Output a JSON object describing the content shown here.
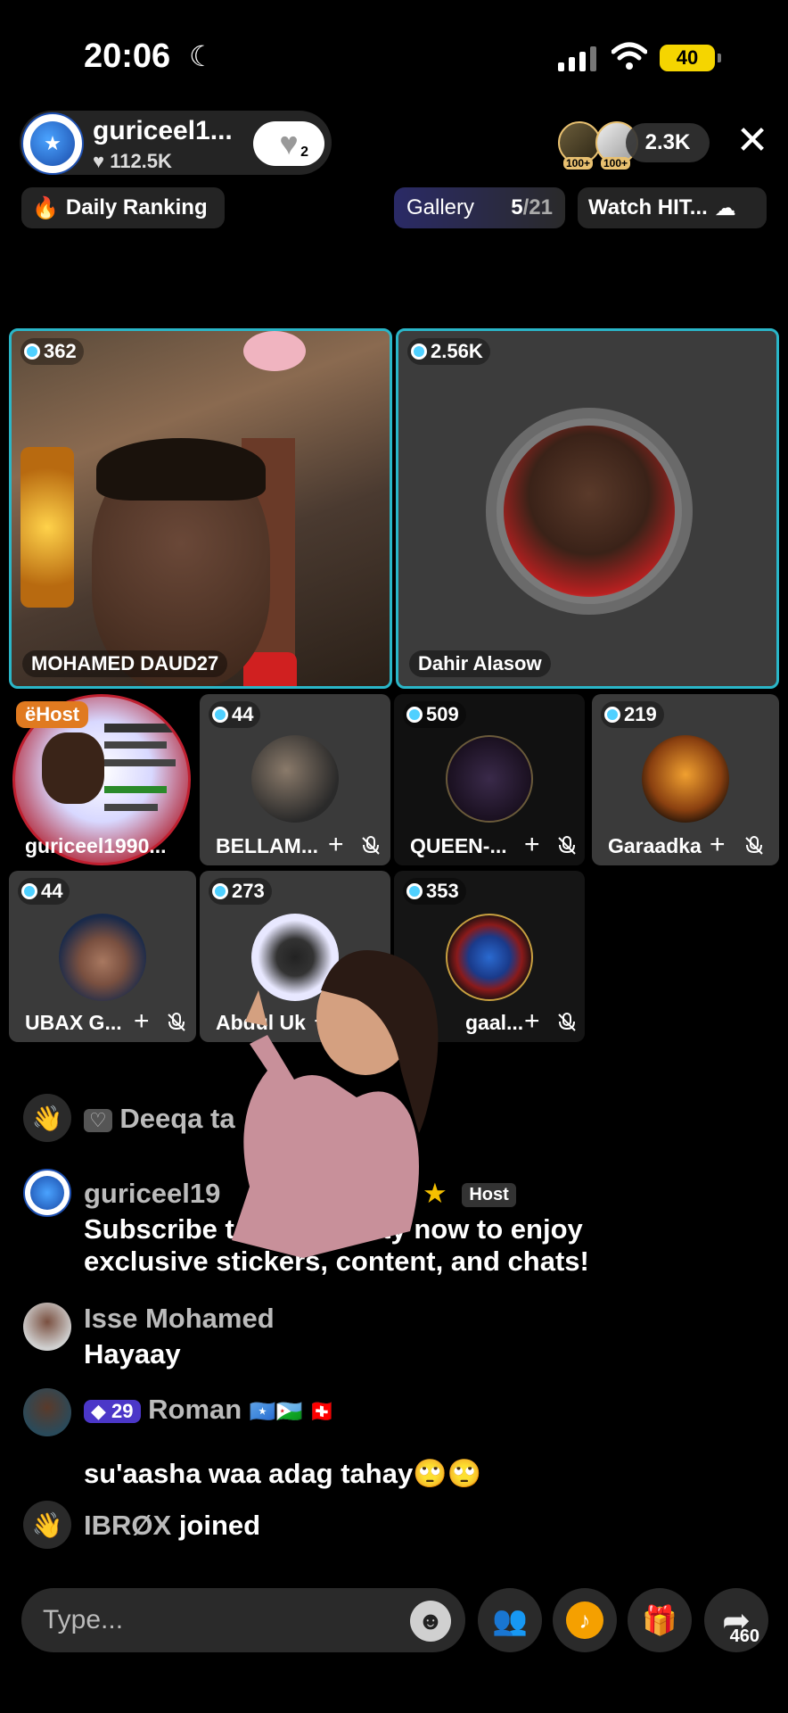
{
  "status": {
    "time": "20:06",
    "battery": "40"
  },
  "host": {
    "name": "guriceel1...",
    "likes": "112.5K",
    "follow_count": "2"
  },
  "viewers": {
    "badge": "100+",
    "count": "2.3K"
  },
  "chips": {
    "ranking": "Daily Ranking",
    "gallery_label": "Gallery",
    "gallery_current": "5",
    "gallery_total": "/21",
    "watch": "Watch HIT..."
  },
  "guests": [
    {
      "count": "362",
      "name": "MOHAMED DAUD27"
    },
    {
      "count": "2.56K",
      "name": "Dahir Alasow"
    },
    {
      "count": "",
      "name": "guriceel1990...",
      "badge": "Host"
    },
    {
      "count": "44",
      "name": "BELLAM..."
    },
    {
      "count": "509",
      "name": "QUEEN-..."
    },
    {
      "count": "219",
      "name": "Garaadka"
    },
    {
      "count": "44",
      "name": "UBAX G..."
    },
    {
      "count": "273",
      "name": "Abdul Uk"
    },
    {
      "count": "353",
      "name": "gaal..."
    }
  ],
  "chat": [
    {
      "name": "Deeqa ta",
      "message": ""
    },
    {
      "name": "guriceel19",
      "name_tail": "ar",
      "badge": "Host",
      "message": "Subscribe to community now to enjoy exclusive stickers, content, and chats!"
    },
    {
      "name": "Isse Mohamed",
      "message": "Hayaay"
    },
    {
      "level": "29",
      "name": "Roman",
      "message": "su'aasha waa adag tahay🙄🙄"
    },
    {
      "name": "IBRØX",
      "message": "joined"
    }
  ],
  "input": {
    "placeholder": "Type..."
  },
  "share_count": "460",
  "colors": {
    "active_border": "#2ab6c8",
    "background": "#000000",
    "level_badge": "#4b37c8"
  }
}
